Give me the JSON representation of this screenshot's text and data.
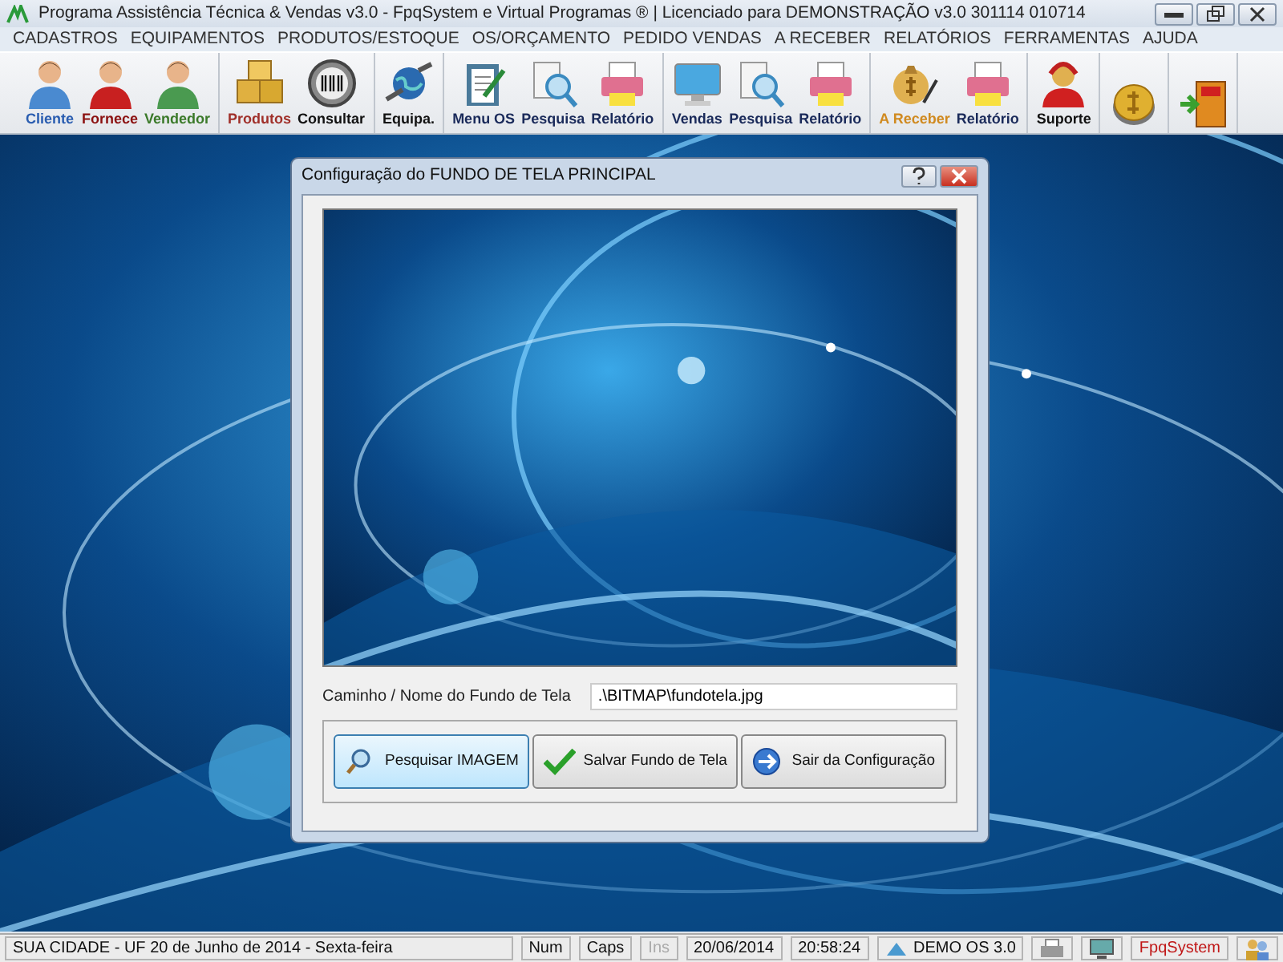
{
  "window": {
    "title": "Programa Assistência Técnica & Vendas v3.0 - FpqSystem e Virtual Programas ® | Licenciado para  DEMONSTRAÇÃO v3.0 301114 010714"
  },
  "menu": [
    "CADASTROS",
    "EQUIPAMENTOS",
    "PRODUTOS/ESTOQUE",
    "OS/ORÇAMENTO",
    "PEDIDO VENDAS",
    "A RECEBER",
    "RELATÓRIOS",
    "FERRAMENTAS",
    "AJUDA"
  ],
  "toolbar": {
    "groups": [
      [
        {
          "kind": "person",
          "label": "Cliente",
          "color": "#2a5db0"
        },
        {
          "kind": "person-red",
          "label": "Fornece",
          "color": "#8b1010"
        },
        {
          "kind": "person-green",
          "label": "Vendedor",
          "color": "#3b7a2a"
        }
      ],
      [
        {
          "kind": "boxes",
          "label": "Produtos",
          "color": "#a0302a"
        },
        {
          "kind": "barcode",
          "label": "Consultar",
          "color": "#111111"
        }
      ],
      [
        {
          "kind": "globe",
          "label": "Equipa.",
          "color": "#111111"
        }
      ],
      [
        {
          "kind": "clipboard",
          "label": "Menu OS",
          "color": "#1a2a5a"
        },
        {
          "kind": "search",
          "label": "Pesquisa",
          "color": "#1a2a5a"
        },
        {
          "kind": "printer",
          "label": "Relatório",
          "color": "#1a2a5a"
        }
      ],
      [
        {
          "kind": "monitor",
          "label": "Vendas",
          "color": "#1a2a5a"
        },
        {
          "kind": "search",
          "label": "Pesquisa",
          "color": "#1a2a5a"
        },
        {
          "kind": "printer",
          "label": "Relatório",
          "color": "#1a2a5a"
        }
      ],
      [
        {
          "kind": "money",
          "label": "A Receber",
          "color": "#d08a20"
        },
        {
          "kind": "printer",
          "label": "Relatório",
          "color": "#1a2a5a"
        }
      ],
      [
        {
          "kind": "support",
          "label": "Suporte",
          "color": "#111111"
        }
      ],
      [
        {
          "kind": "coin"
        }
      ],
      [
        {
          "kind": "exit"
        }
      ]
    ]
  },
  "dialog": {
    "title": "Configuração do FUNDO DE TELA PRINCIPAL",
    "path_label": "Caminho / Nome do Fundo de Tela",
    "path_value": ".\\BITMAP\\fundotela.jpg",
    "buttons": [
      {
        "kind": "search",
        "label": "Pesquisar IMAGEM",
        "selected": true
      },
      {
        "kind": "check",
        "label": "Salvar Fundo de Tela",
        "selected": false
      },
      {
        "kind": "exit",
        "label": "Sair da Configuração",
        "selected": false
      }
    ]
  },
  "status_bar": [
    {
      "kind": "text",
      "text": "SUA CIDADE - UF 20 de Junho de 2014 - Sexta-feira",
      "disabled": false
    },
    {
      "kind": "text",
      "text": "Num",
      "disabled": false
    },
    {
      "kind": "text",
      "text": "Caps",
      "disabled": false
    },
    {
      "kind": "text",
      "text": "Ins",
      "disabled": true
    },
    {
      "kind": "text",
      "text": "20/06/2014",
      "disabled": false
    },
    {
      "kind": "text",
      "text": "20:58:24",
      "disabled": false
    },
    {
      "kind": "icon-text",
      "text": "DEMO OS 3.0",
      "disabled": false
    },
    {
      "kind": "printer"
    },
    {
      "kind": "monitor"
    },
    {
      "kind": "brand",
      "text": "FpqSystem"
    },
    {
      "kind": "users"
    }
  ]
}
